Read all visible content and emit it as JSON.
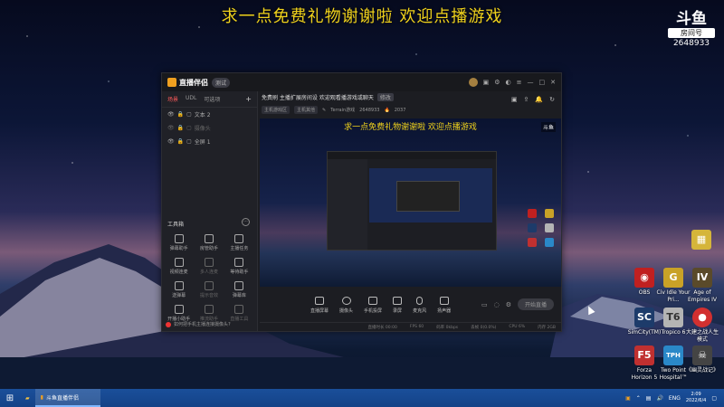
{
  "overlay": {
    "title": "求一点免费礼物谢谢啦 欢迎点播游戏",
    "logo_mark": "斗鱼",
    "logo_sub": "房间号",
    "room_number": "2648933"
  },
  "window": {
    "app_name": "直播伴侣",
    "version_badge": "测试",
    "tabs": [
      "场景",
      "UDL",
      "可选项"
    ],
    "scenes": [
      {
        "label": "文本 2"
      },
      {
        "label": "摄像头"
      },
      {
        "label": "全屏 1"
      }
    ],
    "tools_title": "工具箱",
    "tools": [
      {
        "label": "弹幕助手",
        "enabled": true
      },
      {
        "label": "房管助手",
        "enabled": true
      },
      {
        "label": "主播任务",
        "enabled": true
      },
      {
        "label": "视频连麦",
        "enabled": true
      },
      {
        "label": "多人连麦",
        "enabled": false
      },
      {
        "label": "等待助手",
        "enabled": true
      },
      {
        "label": "送弹幕",
        "enabled": true
      },
      {
        "label": "提示音效",
        "enabled": false
      },
      {
        "label": "弹幕库",
        "enabled": true
      },
      {
        "label": "开播小助手",
        "enabled": true
      },
      {
        "label": "推流助手",
        "enabled": false
      },
      {
        "label": "直播工具",
        "enabled": false
      }
    ],
    "left_footer": "如何把手机主播连接摄像头?",
    "room_title": "免费刷 主播扩展房间设 欢迎观看播游戏或聊天",
    "room_title_tag": "修改",
    "room_chips": [
      "主机游戏区",
      "主机其他"
    ],
    "room_meta": [
      "Terrain游戏",
      "2648933",
      "2037"
    ],
    "preview_title": "求一点免费礼物谢谢啦 欢迎点播游戏",
    "preview_logo": "斗鱼",
    "controls": [
      "直播屏幕",
      "摄像头",
      "手机投屏",
      "录屏",
      "麦克风",
      "扬声器"
    ],
    "go_live_label": "开始直播",
    "status": [
      "直播时长 00:00",
      "FPS 60",
      "码率 0kbps",
      "丢帧 0(0.0%)",
      "CPU 6%",
      "内存 2GB"
    ]
  },
  "desktop_icons": [
    {
      "label": "",
      "color": "#d5b53a",
      "glyph": "🎮"
    },
    {
      "label": "OBS",
      "color": "#c02020",
      "glyph": "◉"
    },
    {
      "label": "Civ Idle Your Pri...",
      "color": "#c9a227",
      "glyph": "G"
    },
    {
      "label": "Age of Empires IV",
      "color": "#5a4a2a",
      "glyph": "IV"
    },
    {
      "label": "SimCity(TM)",
      "color": "#1d3b6a",
      "glyph": "SC"
    },
    {
      "label": "Tropico 6",
      "color": "#b4b4b4",
      "glyph": "T6"
    },
    {
      "label": "大建之战人生模式",
      "color": "#d23030",
      "glyph": "●"
    },
    {
      "label": "Forza Horizon 5",
      "color": "#c03030",
      "glyph": "F5"
    },
    {
      "label": "Two Point Hospital™",
      "color": "#2a88c8",
      "glyph": "TPH"
    },
    {
      "label": "《幽灵战记》",
      "color": "#444",
      "glyph": "☠"
    }
  ],
  "taskbar": {
    "app_label": "斗鱼直播伴侣",
    "lang": "ENG",
    "time": "2:09",
    "date": "2022/6/4"
  }
}
